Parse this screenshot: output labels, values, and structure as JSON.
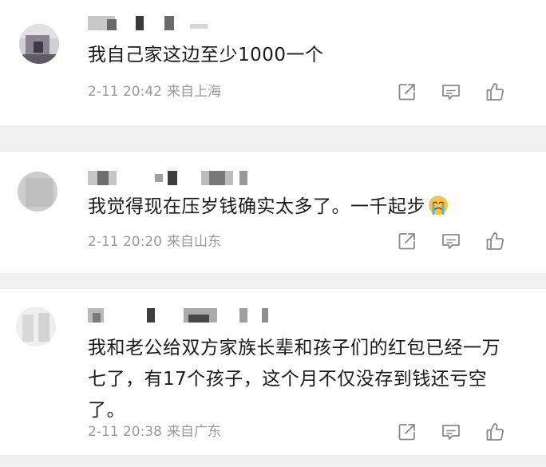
{
  "comments": [
    {
      "text": "我自己家这边至少1000一个",
      "time": "2-11 20:42",
      "location": "来自上海"
    },
    {
      "text": "我觉得现在压岁钱确实太多了。一千起步",
      "emoji": "crying-face-icon",
      "time": "2-11 20:20",
      "location": "来自山东"
    },
    {
      "text_lines": [
        "我和老公给双方家族长辈和孩子们的红包已经一万",
        "七了，有17个孩子，这个月不仅没存到钱还亏空",
        "了。"
      ],
      "time": "2-11 20:38",
      "location": "来自广东"
    }
  ],
  "actions": [
    "share-icon",
    "comment-icon",
    "like-icon"
  ],
  "colors": {
    "background": "#f1f1f1",
    "card": "#ffffff",
    "text": "#1a1a1a",
    "meta": "#9a9a9a",
    "icon": "#8a8a8a"
  }
}
